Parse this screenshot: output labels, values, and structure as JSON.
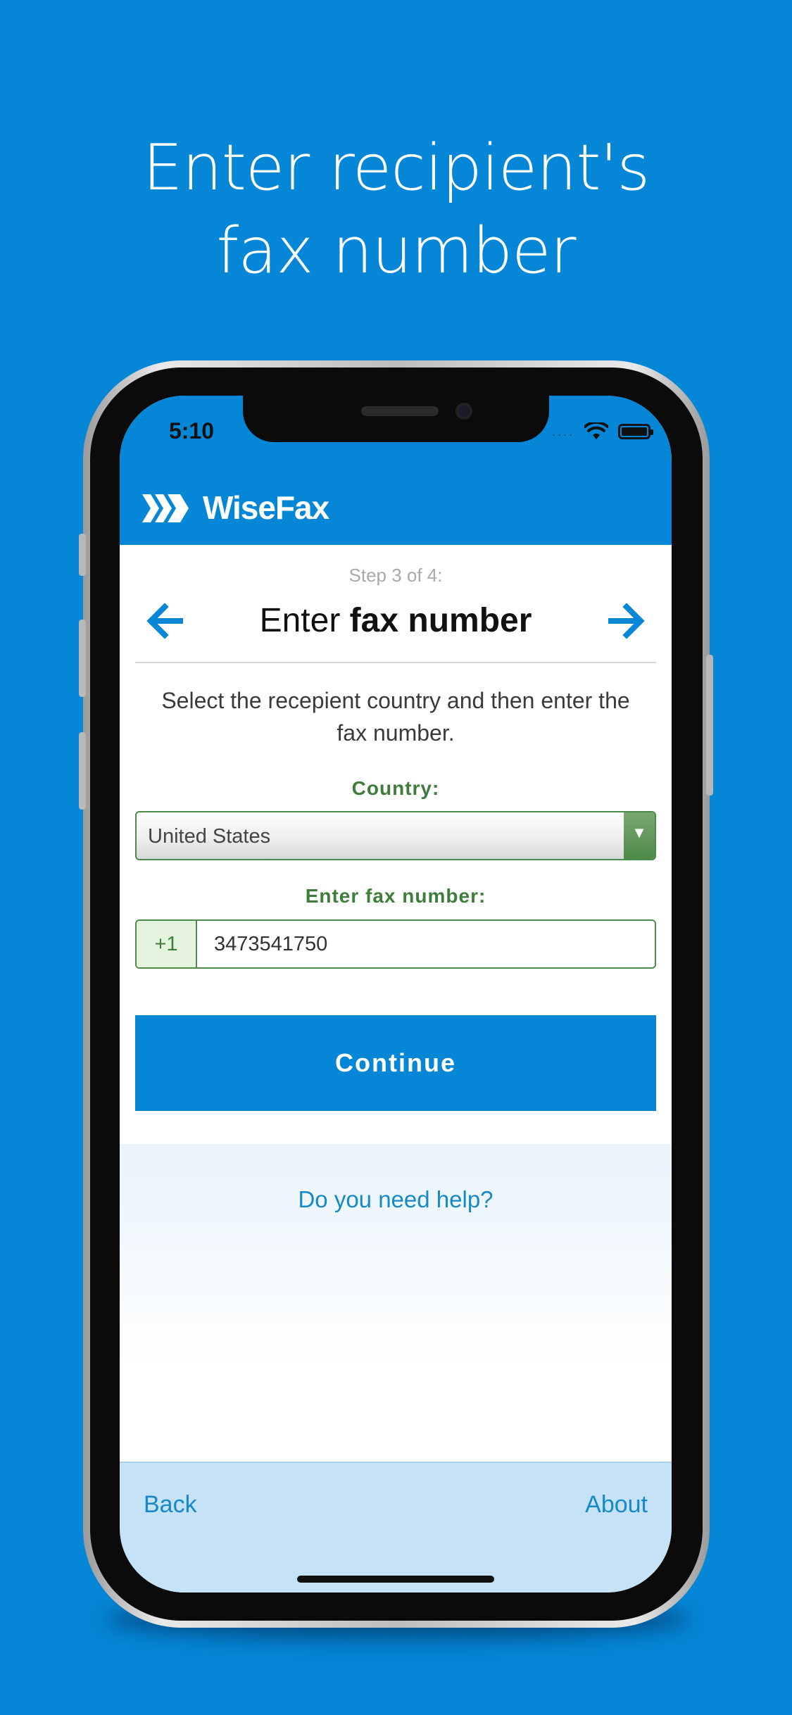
{
  "promo": {
    "headline_line1": "Enter recipient's",
    "headline_line2": "fax number"
  },
  "status_bar": {
    "time": "5:10",
    "dots": "....",
    "icons": [
      "wifi-icon",
      "battery-icon"
    ]
  },
  "app": {
    "name": "WiseFax",
    "logo_icon": "chevrons-logo-icon",
    "brand_color": "#0586d6"
  },
  "wizard": {
    "step": "Step 3 of 4:",
    "title_regular": "Enter",
    "title_bold": "fax number",
    "back_arrow_icon": "arrow-left-icon",
    "next_arrow_icon": "arrow-right-icon"
  },
  "form": {
    "instructions": "Select the recepient country and then enter the fax number.",
    "country_label": "Country:",
    "country_value": "United States",
    "fax_label": "Enter fax number:",
    "country_code": "+1",
    "fax_value": "3473541750",
    "continue_label": "Continue",
    "accent_green": "#4e8a48"
  },
  "help": {
    "link": "Do you need help?"
  },
  "footer": {
    "back": "Back",
    "about": "About"
  }
}
